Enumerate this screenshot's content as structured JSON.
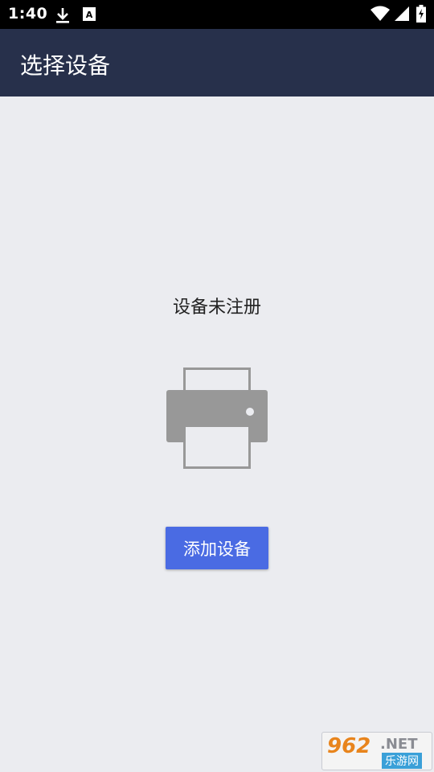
{
  "status_bar": {
    "time": "1:40",
    "icons": [
      "download-icon",
      "a-badge-icon",
      "wifi-icon",
      "signal-icon",
      "battery-icon"
    ]
  },
  "app_bar": {
    "title": "选择设备",
    "background": "#27304b"
  },
  "main": {
    "empty_message": "设备未注册",
    "printer_icon": "printer-icon",
    "add_button_label": "添加设备",
    "accent": "#4a6be3",
    "background": "#ebecf0"
  },
  "watermark": {
    "number": "962",
    "domain": ".NET",
    "site_name": "乐游网"
  }
}
